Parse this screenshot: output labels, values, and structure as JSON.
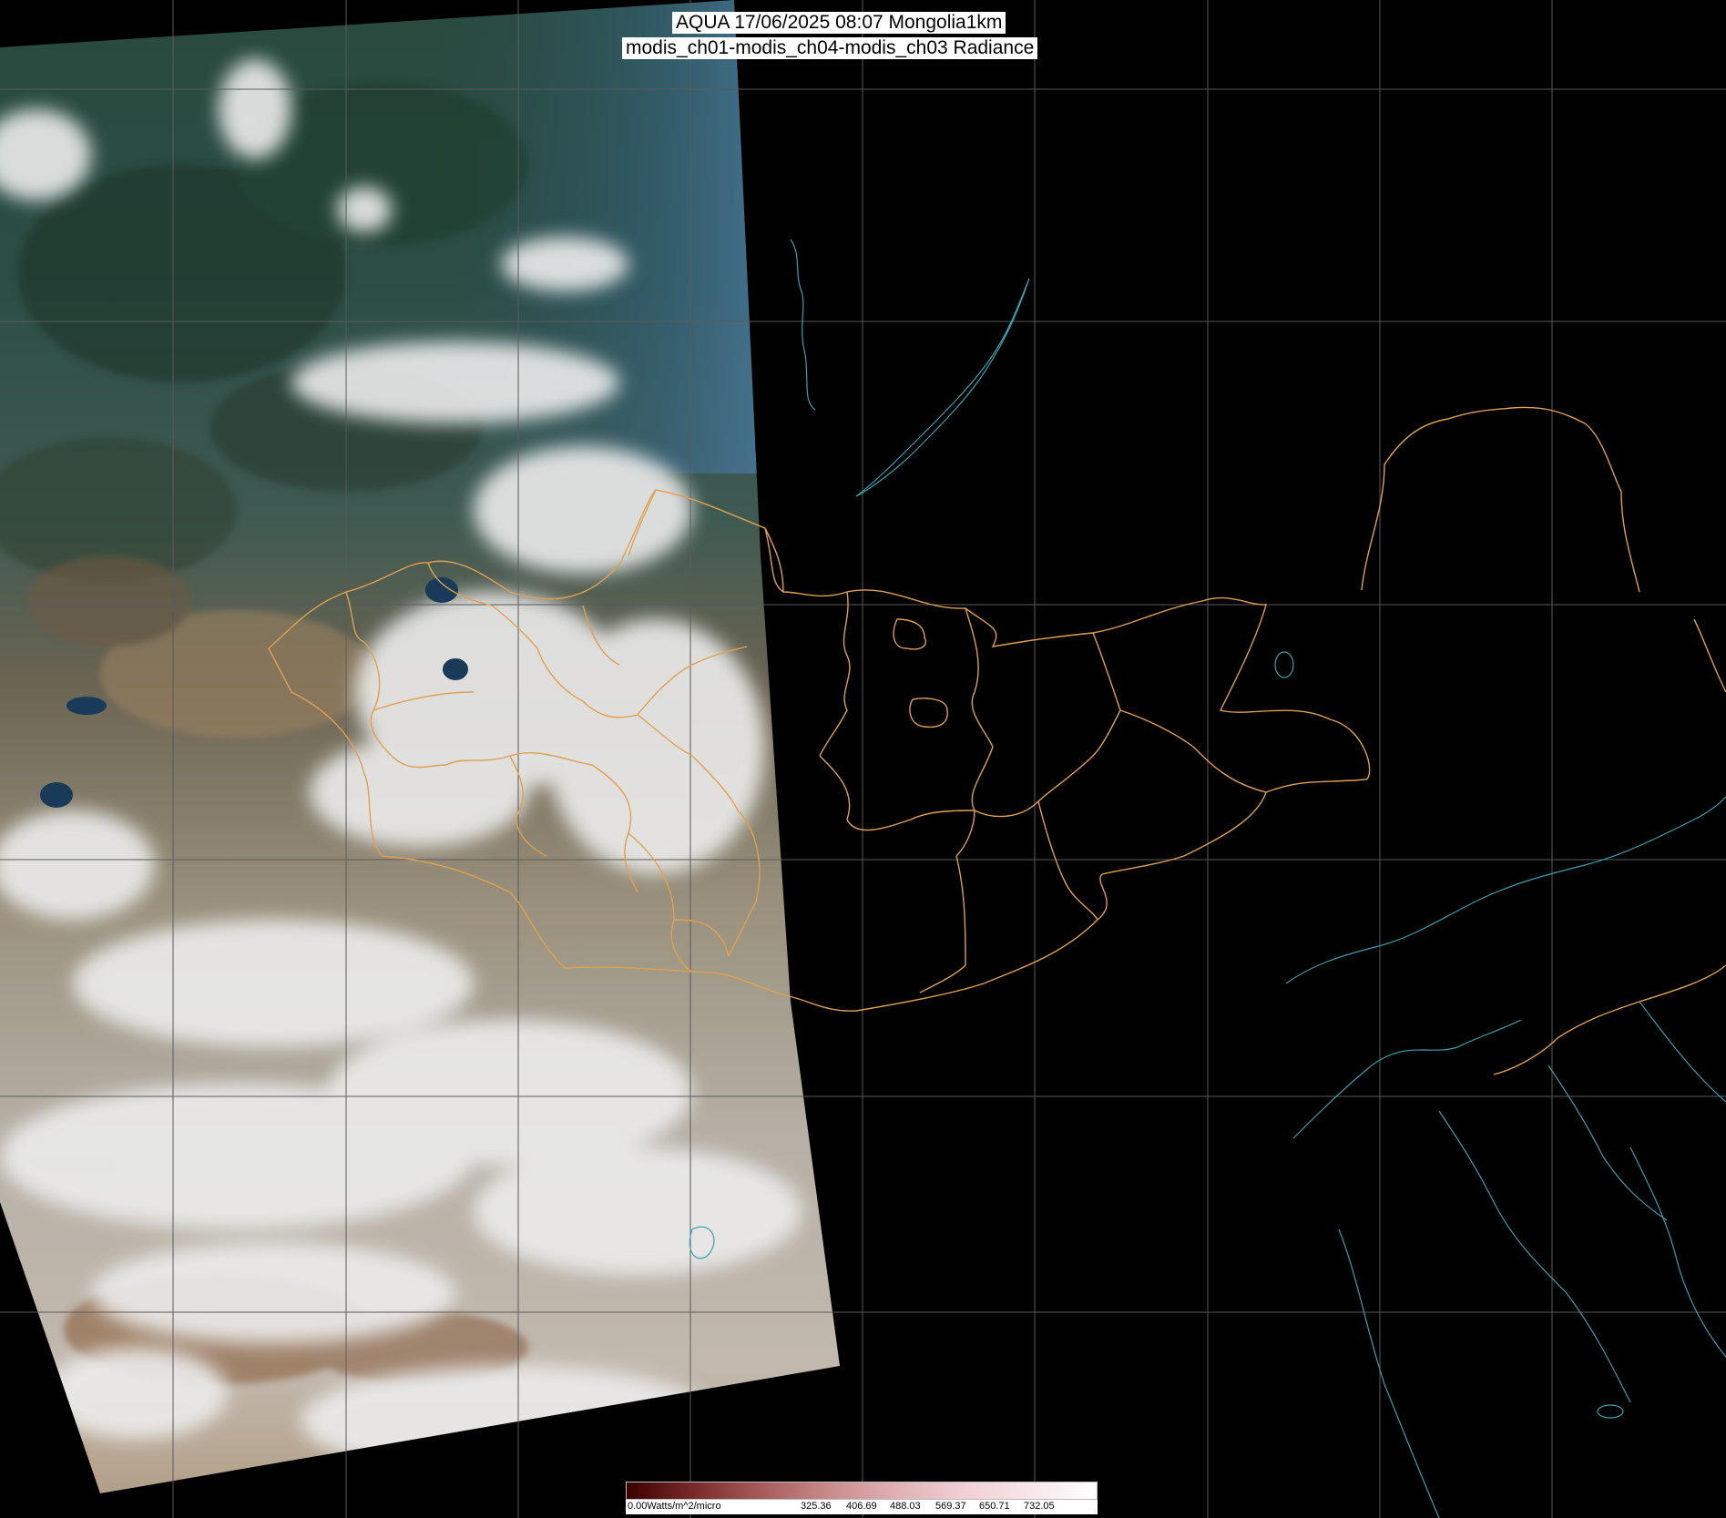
{
  "title": {
    "line1": "AQUA 17/06/2025 08:07 Mongolia1km",
    "line2": "modis_ch01-modis_ch04-modis_ch03 Radiance"
  },
  "colorbar": {
    "min_label": "0.00Watts/m^2/micro",
    "ticks": [
      "325.36",
      "406.69",
      "488.03",
      "569.37",
      "650.71",
      "732.05"
    ],
    "colors": [
      "#3a0000",
      "#7a2a2a",
      "#a85a5a",
      "#c98a8a",
      "#e0b0b4",
      "#f0cfd3",
      "#f8e6e8",
      "#ffffff"
    ]
  },
  "colors": {
    "background": "#000000",
    "graticule": "#5a5a5a",
    "admin_boundary": "#e0a050",
    "coastline": "#3aa0b0",
    "forest": "#23412f",
    "steppe": "#8a7a5c",
    "cloud": "#e8e8e8",
    "sea_ice": "#3a6a8a"
  }
}
